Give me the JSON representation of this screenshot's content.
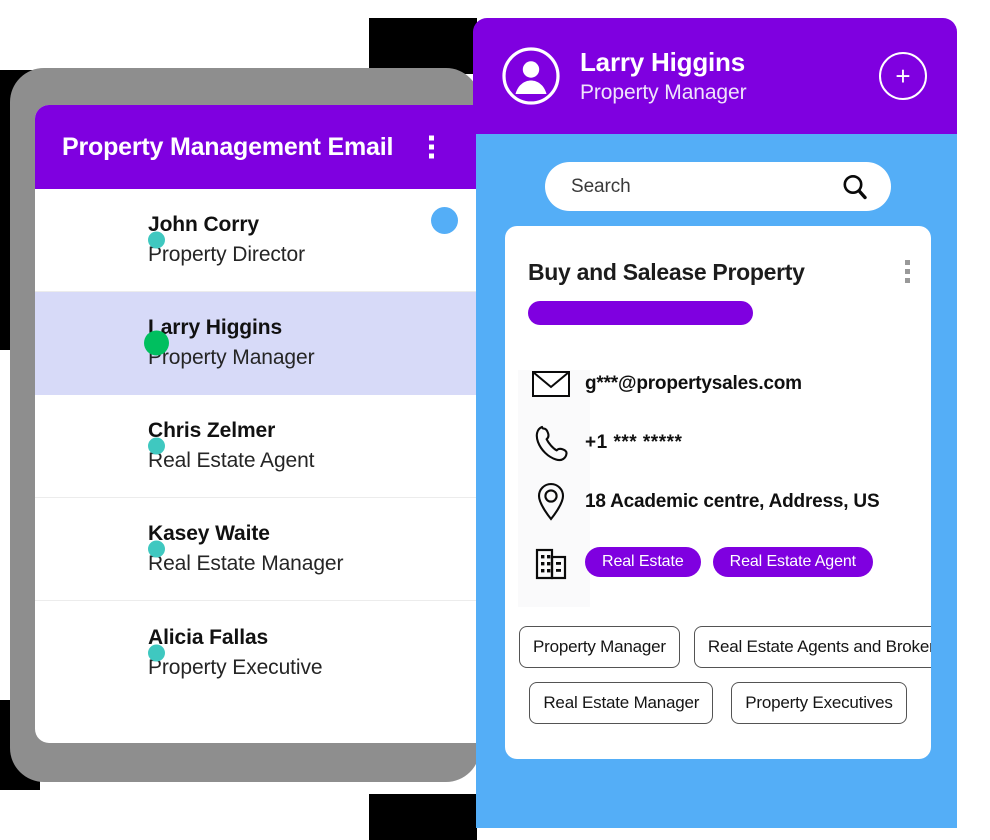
{
  "left_window": {
    "header": {
      "title": "Property Management Email",
      "menu_icon": "kebab-menu-icon"
    },
    "contacts": [
      {
        "name": "John Corry",
        "role": "Property Director",
        "status_color": "#3fc8c0",
        "selected": false,
        "badge": true
      },
      {
        "name": "Larry Higgins",
        "role": "Property Manager",
        "status_color": "#00bf5f",
        "selected": true,
        "badge": false
      },
      {
        "name": "Chris Zelmer",
        "role": "Real Estate Agent",
        "status_color": "#3fc8c0",
        "selected": false,
        "badge": false
      },
      {
        "name": "Kasey Waite",
        "role": "Real Estate Manager",
        "status_color": "#3fc8c0",
        "selected": false,
        "badge": false
      },
      {
        "name": "Alicia Fallas",
        "role": "Property Executive",
        "status_color": "#3fc8c0",
        "selected": false,
        "badge": false
      }
    ]
  },
  "right_window": {
    "header": {
      "avatar_icon": "user-avatar-icon",
      "name": "Larry Higgins",
      "role": "Property Manager",
      "add_label": "+"
    },
    "search": {
      "placeholder": "Search",
      "value": "",
      "icon": "search-icon"
    },
    "card": {
      "title": "Buy and Salease Property",
      "menu_icon": "kebab-menu-icon",
      "info": [
        {
          "icon": "envelope-icon",
          "text": "g***@propertysales.com"
        },
        {
          "icon": "phone-icon",
          "text": "+1  *** *****"
        },
        {
          "icon": "location-pin-icon",
          "text": "18 Academic centre, Address, US"
        }
      ],
      "tags_icon": "office-building-icon",
      "tags": [
        "Real Estate",
        "Real Estate Agent"
      ],
      "chips_row1": [
        "Property Manager",
        "Real Estate Agents and Brokers"
      ],
      "chips_row2": [
        "Real Estate Manager",
        "Property Executives"
      ]
    }
  },
  "colors": {
    "purple": "#7f00e0",
    "blue": "#54aef7",
    "teal": "#3fc8c0",
    "green": "#00bf5f",
    "selected_row": "#d7daf8"
  }
}
